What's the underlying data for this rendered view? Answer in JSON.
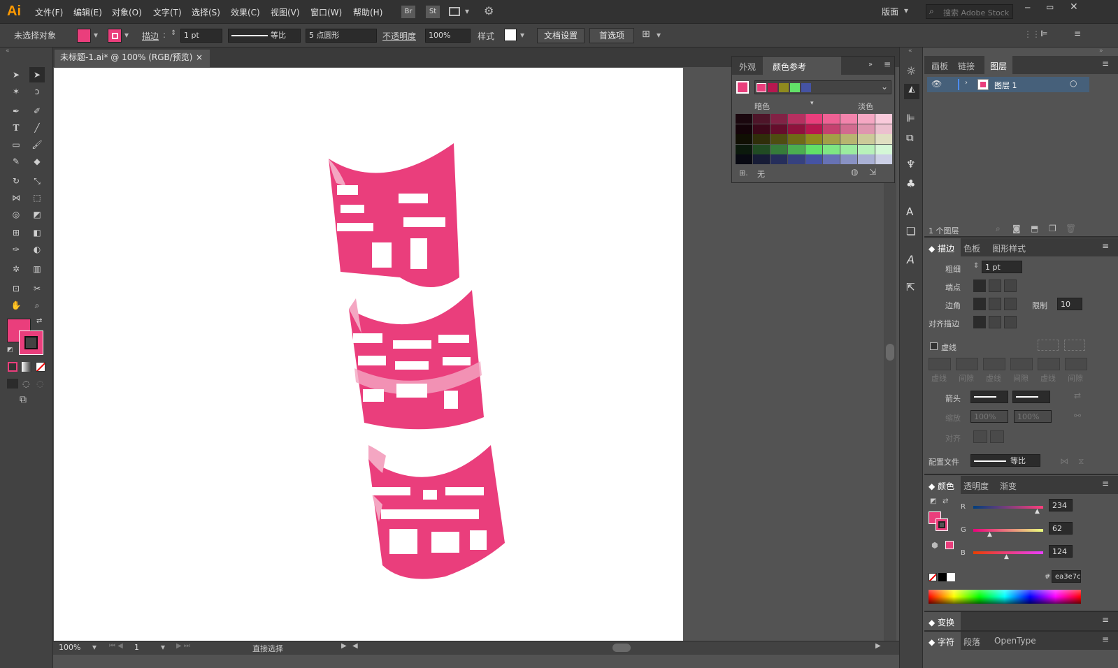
{
  "app": {
    "logo": "Ai",
    "workspace": "版面",
    "search_placeholder": "搜索 Adobe Stock"
  },
  "menu": [
    "文件(F)",
    "编辑(E)",
    "对象(O)",
    "文字(T)",
    "选择(S)",
    "效果(C)",
    "视图(V)",
    "窗口(W)",
    "帮助(H)"
  ],
  "bridge": {
    "br": "Br",
    "st": "St"
  },
  "control": {
    "selection": "未选择对象",
    "stroke_label": "描边",
    "stroke_weight": "1 pt",
    "stroke_profile": "等比",
    "brush": "5 点圆形",
    "opacity_label": "不透明度",
    "opacity": "100%",
    "style_label": "样式",
    "doc_setup": "文档设置",
    "prefs": "首选项"
  },
  "document": {
    "tab_title": "未标题-1.ai* @ 100% (RGB/预览)",
    "close": "×"
  },
  "status": {
    "zoom": "100%",
    "page": "1",
    "tool": "直接选择"
  },
  "colors": {
    "accent": "#ea3e7c",
    "fill": "#ea3e7c"
  },
  "artwork": {
    "chars": [
      "野",
      "鹿",
      "志"
    ]
  },
  "color_guide": {
    "tab1": "外观",
    "tab2": "颜色参考",
    "dark_label": "暗色",
    "light_label": "淡色",
    "none_label": "无",
    "base_colors": [
      "#ea3e7c",
      "#b8174f",
      "#8f8a1e",
      "#62e068",
      "#4553a3"
    ]
  },
  "layers": {
    "tabs": [
      "画板",
      "链接",
      "图层"
    ],
    "layer_name": "图层 1",
    "count": "1 个图层"
  },
  "stroke": {
    "tabs": [
      "描边",
      "色板",
      "图形样式"
    ],
    "weight_label": "粗细",
    "weight": "1 pt",
    "cap_label": "端点",
    "corner_label": "边角",
    "limit_label": "限制",
    "limit": "10",
    "align_label": "对齐描边",
    "dashed_label": "虚线",
    "dash_cols": [
      "虚线",
      "间隙",
      "虚线",
      "间隙",
      "虚线",
      "间隙"
    ],
    "arrow_label": "箭头",
    "scale_label": "缩放",
    "scale1": "100%",
    "scale2": "100%",
    "align2_label": "对齐",
    "profile_label": "配置文件",
    "profile": "等比"
  },
  "color": {
    "tabs": [
      "颜色",
      "透明度",
      "渐变"
    ],
    "r_label": "R",
    "g_label": "G",
    "b_label": "B",
    "r": "234",
    "g": "62",
    "b": "124",
    "hex_label": "#",
    "hex": "ea3e7c"
  },
  "transform": {
    "title": "变换"
  },
  "char": {
    "tabs": [
      "字符",
      "段落",
      "OpenType"
    ]
  }
}
